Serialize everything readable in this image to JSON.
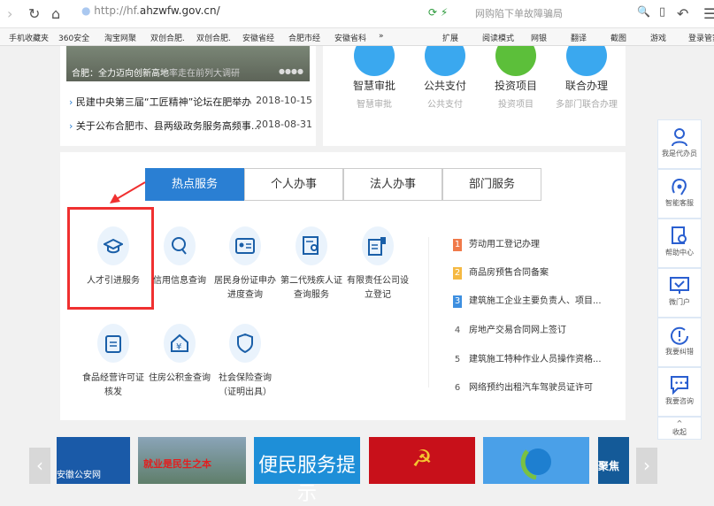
{
  "browser": {
    "url_prefix": "http://hf.",
    "url_domain": "ahzwfw.gov.cn/",
    "search_placeholder": "网购陷下单故障骗局",
    "bookmarks": [
      "手机收藏夹",
      "360安全",
      "淘宝网聚",
      "双创合肥.",
      "双创合肥.",
      "安徽省经",
      "合肥市经",
      "安徽省科",
      "»",
      "扩展",
      "阅读模式",
      "网银",
      "翻译",
      "截图",
      "游戏",
      "登录管家"
    ]
  },
  "news": {
    "caption": "合肥：全力迈向创新高地",
    "caption_overlay": "率走在前列大调研",
    "items": [
      {
        "title": "民建中央第三届“工匠精神”论坛在肥举办",
        "date": "2018-10-15"
      },
      {
        "title": "关于公布合肥市、县两级政务服务高频事...",
        "date": "2018-08-31"
      }
    ]
  },
  "services": [
    {
      "title": "智慧审批",
      "sub": "智慧审批",
      "color": "#3aa8ef"
    },
    {
      "title": "公共支付",
      "sub": "公共支付",
      "color": "#3aa8ef"
    },
    {
      "title": "投资项目",
      "sub": "投资项目",
      "color": "#5cbf3a"
    },
    {
      "title": "联合办理",
      "sub": "多部门联合办理",
      "color": "#3aa8ef"
    }
  ],
  "tabs": [
    "热点服务",
    "个人办事",
    "法人办事",
    "部门服务"
  ],
  "hot_items": [
    [
      "人才引进服务"
    ],
    [
      "信用信息查询"
    ],
    [
      "居民身份证申办",
      "进度查询"
    ],
    [
      "第二代残疾人证",
      "查询服务"
    ],
    [
      "有限责任公司设",
      "立登记"
    ],
    [
      "食品经营许可证",
      "核发"
    ],
    [
      "住房公积金查询"
    ],
    [
      "社会保险查询",
      "（证明出具）"
    ]
  ],
  "ranking": [
    {
      "n": "1",
      "t": "劳动用工登记办理",
      "c": "#f07a4a"
    },
    {
      "n": "2",
      "t": "商品房预售合同备案",
      "c": "#f5b942"
    },
    {
      "n": "3",
      "t": "建筑施工企业主要负责人、项目...",
      "c": "#3d8fe0"
    },
    {
      "n": "4",
      "t": "房地产交易合同网上签订"
    },
    {
      "n": "5",
      "t": "建筑施工特种作业人员操作资格..."
    },
    {
      "n": "6",
      "t": "网络预约出租汽车驾驶员证许可"
    }
  ],
  "sidebar": [
    "我是代办员",
    "智能客服",
    "帮助中心",
    "微门户",
    "我要纠错",
    "我要咨询",
    "收起"
  ],
  "banners": {
    "b1": "安徽公安网",
    "b2": "就业是民生之本",
    "b3": "便民服务提示",
    "b6": "聚焦"
  },
  "colors": {
    "accent": "#2a7fd3",
    "highlight": "#f03030"
  }
}
